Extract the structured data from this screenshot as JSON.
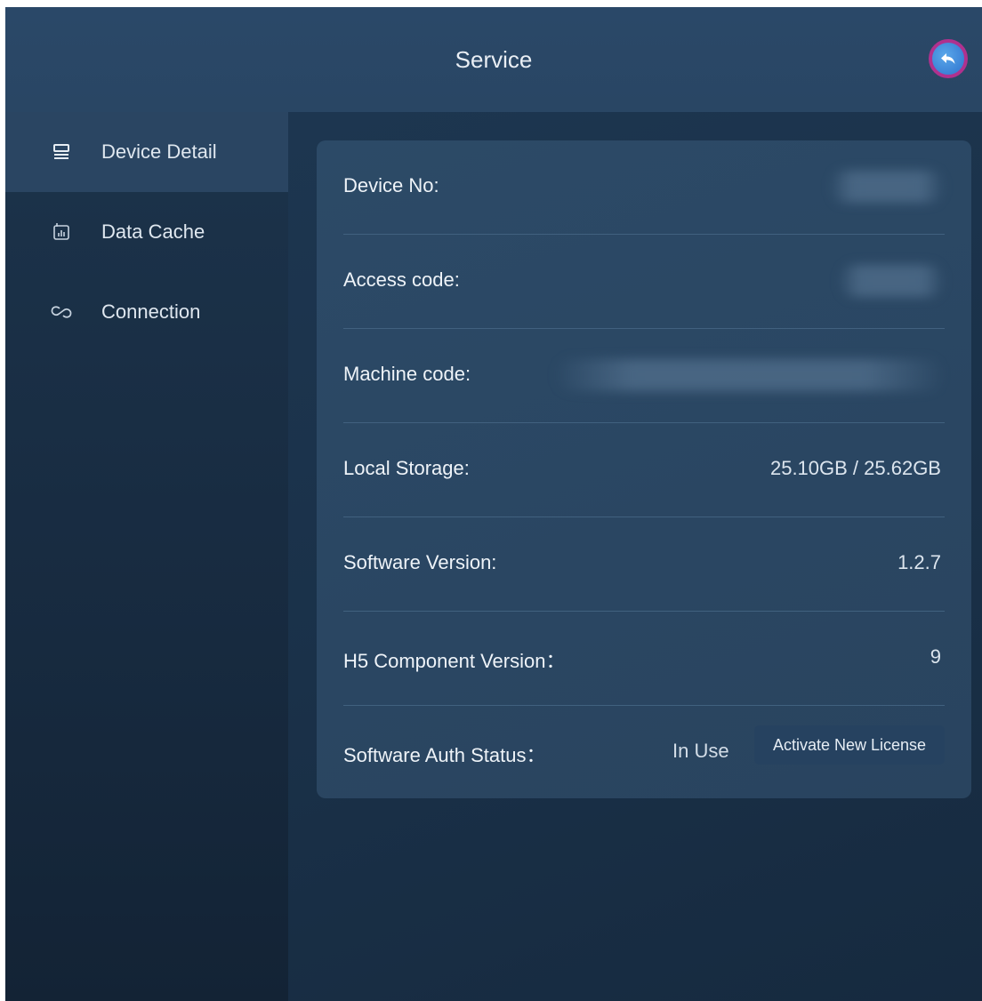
{
  "header": {
    "title": "Service",
    "back_icon": "back-arrow-icon",
    "back_icon_ring_color": "#b0318e",
    "back_icon_fill_color": "#3b82d6"
  },
  "sidebar": {
    "items": [
      {
        "label": "Device Detail",
        "icon": "server-icon",
        "active": true
      },
      {
        "label": "Data Cache",
        "icon": "chart-icon",
        "active": false
      },
      {
        "label": "Connection",
        "icon": "link-icon",
        "active": false
      }
    ]
  },
  "details": {
    "device_no": {
      "label": "Device No:"
    },
    "access_code": {
      "label": "Access code:"
    },
    "machine_code": {
      "label": "Machine code:"
    },
    "local_storage": {
      "label": "Local Storage:",
      "value": "25.10GB / 25.62GB"
    },
    "software_version": {
      "label": "Software Version:",
      "value": "1.2.7"
    },
    "h5_component_version": {
      "label": "H5 Component Version：",
      "value": "9"
    },
    "software_auth_status": {
      "label": "Software Auth Status：",
      "value": "In Use",
      "button_label": "Activate New License"
    }
  },
  "colors": {
    "background": "#1a3048",
    "header": "#294664",
    "card": "#2a4662",
    "active_sidebar_item": "#2a4562"
  }
}
